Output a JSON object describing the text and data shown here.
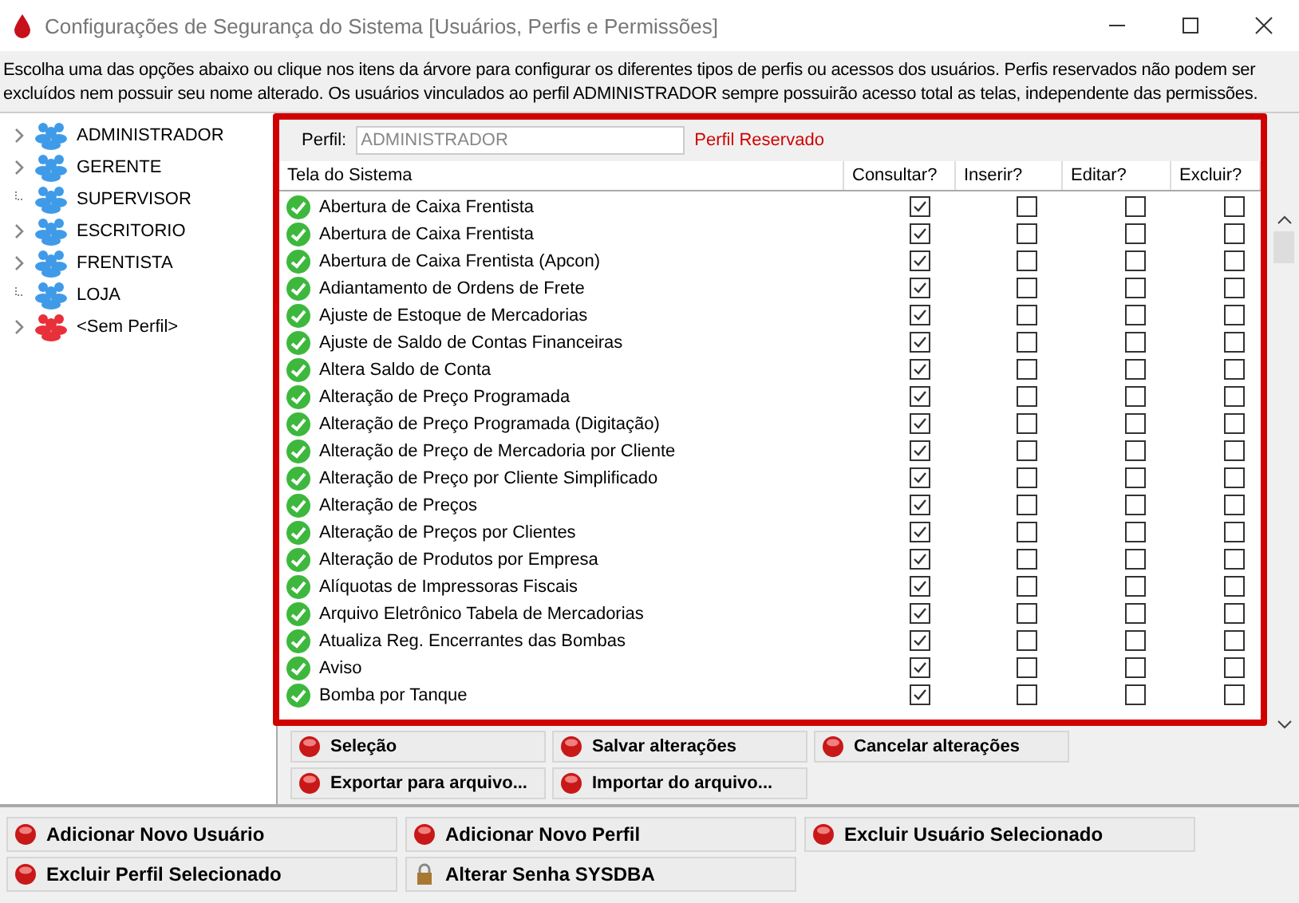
{
  "window": {
    "title": "Configurações de Segurança do Sistema [Usuários, Perfis e Permissões]"
  },
  "description": "Escolha uma das opções abaixo ou clique nos itens da árvore para configurar os diferentes tipos de perfis ou acessos dos usuários. Perfis reservados não podem ser excluídos nem possuir seu nome alterado. Os usuários vinculados ao perfil ADMINISTRADOR sempre possuirão acesso total as telas, independente das permissões.",
  "tree": [
    {
      "label": "ADMINISTRADOR",
      "expandable": true,
      "color": "#3f9be8"
    },
    {
      "label": "GERENTE",
      "expandable": true,
      "color": "#3f9be8"
    },
    {
      "label": "SUPERVISOR",
      "expandable": false,
      "color": "#3f9be8"
    },
    {
      "label": "ESCRITORIO",
      "expandable": true,
      "color": "#3f9be8"
    },
    {
      "label": "FRENTISTA",
      "expandable": true,
      "color": "#3f9be8"
    },
    {
      "label": "LOJA",
      "expandable": false,
      "color": "#3f9be8"
    },
    {
      "label": "<Sem Perfil>",
      "expandable": true,
      "color": "#e8303a"
    }
  ],
  "profile": {
    "label": "Perfil:",
    "value": "ADMINISTRADOR",
    "note": "Perfil Reservado"
  },
  "table": {
    "columns": [
      "Tela do Sistema",
      "Consultar?",
      "Inserir?",
      "Editar?",
      "Excluir?"
    ],
    "rows": [
      {
        "name": "Abertura de Caixa Frentista",
        "perms": [
          true,
          false,
          false,
          false
        ]
      },
      {
        "name": "Abertura de Caixa Frentista",
        "perms": [
          true,
          false,
          false,
          false
        ]
      },
      {
        "name": "Abertura de Caixa Frentista (Apcon)",
        "perms": [
          true,
          false,
          false,
          false
        ]
      },
      {
        "name": "Adiantamento de Ordens de Frete",
        "perms": [
          true,
          false,
          false,
          false
        ]
      },
      {
        "name": "Ajuste de Estoque de Mercadorias",
        "perms": [
          true,
          false,
          false,
          false
        ]
      },
      {
        "name": "Ajuste de Saldo de Contas Financeiras",
        "perms": [
          true,
          false,
          false,
          false
        ]
      },
      {
        "name": "Altera Saldo de Conta",
        "perms": [
          true,
          false,
          false,
          false
        ]
      },
      {
        "name": "Alteração de Preço Programada",
        "perms": [
          true,
          false,
          false,
          false
        ]
      },
      {
        "name": "Alteração de Preço Programada (Digitação)",
        "perms": [
          true,
          false,
          false,
          false
        ]
      },
      {
        "name": "Alteração de Preço de Mercadoria por Cliente",
        "perms": [
          true,
          false,
          false,
          false
        ]
      },
      {
        "name": "Alteração de Preço por Cliente Simplificado",
        "perms": [
          true,
          false,
          false,
          false
        ]
      },
      {
        "name": "Alteração de Preços",
        "perms": [
          true,
          false,
          false,
          false
        ]
      },
      {
        "name": "Alteração de Preços por Clientes",
        "perms": [
          true,
          false,
          false,
          false
        ]
      },
      {
        "name": "Alteração de Produtos por Empresa",
        "perms": [
          true,
          false,
          false,
          false
        ]
      },
      {
        "name": "Alíquotas de Impressoras Fiscais",
        "perms": [
          true,
          false,
          false,
          false
        ]
      },
      {
        "name": "Arquivo Eletrônico Tabela de Mercadorias",
        "perms": [
          true,
          false,
          false,
          false
        ]
      },
      {
        "name": "Atualiza Reg. Encerrantes das Bombas",
        "perms": [
          true,
          false,
          false,
          false
        ]
      },
      {
        "name": "Aviso",
        "perms": [
          true,
          false,
          false,
          false
        ]
      },
      {
        "name": "Bomba por Tanque",
        "perms": [
          true,
          false,
          false,
          false
        ]
      }
    ]
  },
  "panel_buttons": [
    {
      "label": "Seleção",
      "kind": "action"
    },
    {
      "label": "Salvar alterações",
      "kind": "action"
    },
    {
      "label": "Cancelar alterações",
      "kind": "action"
    },
    {
      "label": "Exportar para arquivo...",
      "kind": "action"
    },
    {
      "label": "Importar do arquivo...",
      "kind": "action"
    }
  ],
  "bottom_buttons": [
    {
      "label": "Adicionar Novo Usuário",
      "kind": "action"
    },
    {
      "label": "Adicionar Novo Perfil",
      "kind": "action"
    },
    {
      "label": "Excluir Usuário Selecionado",
      "kind": "action"
    },
    {
      "label": "Excluir Perfil Selecionado",
      "kind": "action"
    },
    {
      "label": "Alterar Senha SYSDBA",
      "kind": "security"
    }
  ]
}
